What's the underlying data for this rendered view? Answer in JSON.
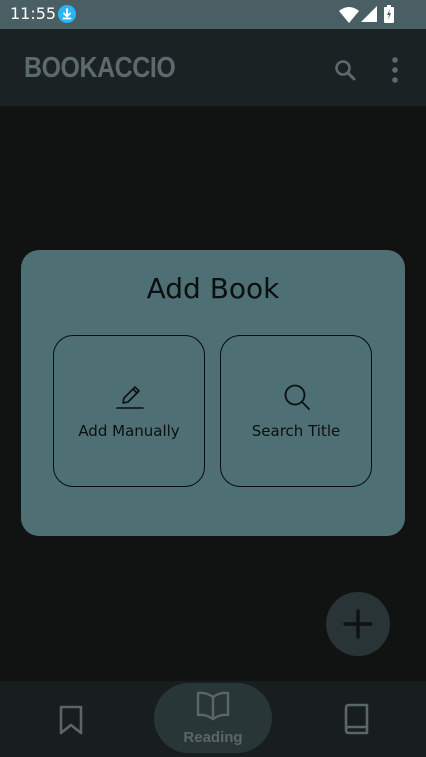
{
  "status_bar": {
    "time": "11:55",
    "icons": [
      "download-icon",
      "wifi-icon",
      "signal-icon",
      "battery-icon"
    ]
  },
  "app_bar": {
    "title": "BOOKACCIO",
    "actions": [
      "search-icon",
      "more-vert-icon"
    ]
  },
  "dialog": {
    "title": "Add Book",
    "options": [
      {
        "label": "Add Manually",
        "icon": "pencil-icon"
      },
      {
        "label": "Search Title",
        "icon": "search-icon"
      }
    ]
  },
  "fab": {
    "icon": "plus-icon"
  },
  "bottom_nav": {
    "items": [
      {
        "icon": "bookmark-icon",
        "label": ""
      },
      {
        "icon": "open-book-icon",
        "label": "Reading",
        "selected": true
      },
      {
        "icon": "book-icon",
        "label": ""
      }
    ]
  },
  "colors": {
    "status_bar": "#4a5f63",
    "app_bar": "#1a2224",
    "scrim_background": "#111313",
    "dialog": "#4e6f74",
    "nav_bar": "#181d1e",
    "nav_selected_pill": "#283638"
  }
}
